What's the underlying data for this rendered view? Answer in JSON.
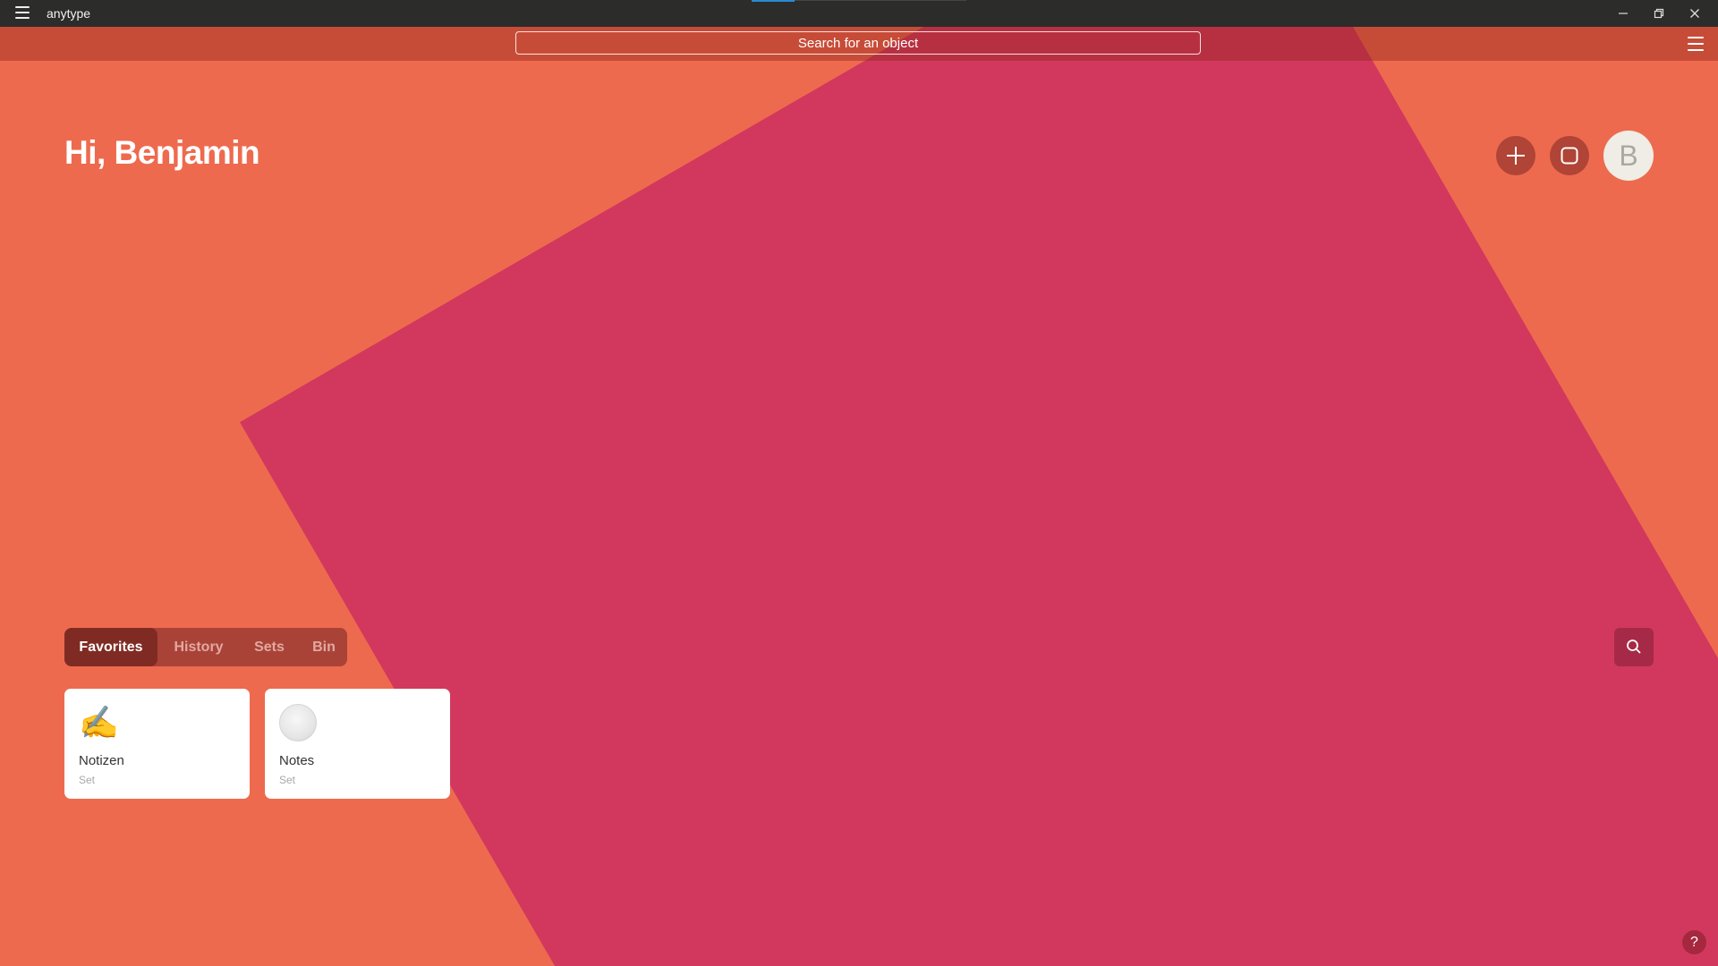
{
  "window": {
    "app_title": "anytype"
  },
  "search": {
    "placeholder": "Search for an object"
  },
  "home": {
    "greeting": "Hi, Benjamin",
    "avatar_letter": "B"
  },
  "tabs": [
    {
      "label": "Favorites",
      "active": true
    },
    {
      "label": "History",
      "active": false
    },
    {
      "label": "Sets",
      "active": false
    },
    {
      "label": "Bin",
      "active": false
    }
  ],
  "cards": [
    {
      "title": "Notizen",
      "type": "Set",
      "icon": "writing-hand-emoji"
    },
    {
      "title": "Notes",
      "type": "Set",
      "icon": "grey-circle-icon"
    }
  ],
  "help": {
    "label": "?"
  },
  "colors": {
    "background": "#EE6A4E",
    "shape": "#D2385D",
    "titlebar": "#2C2C2B",
    "tab_bar": "#A94338",
    "tab_active": "#7F2B24"
  }
}
